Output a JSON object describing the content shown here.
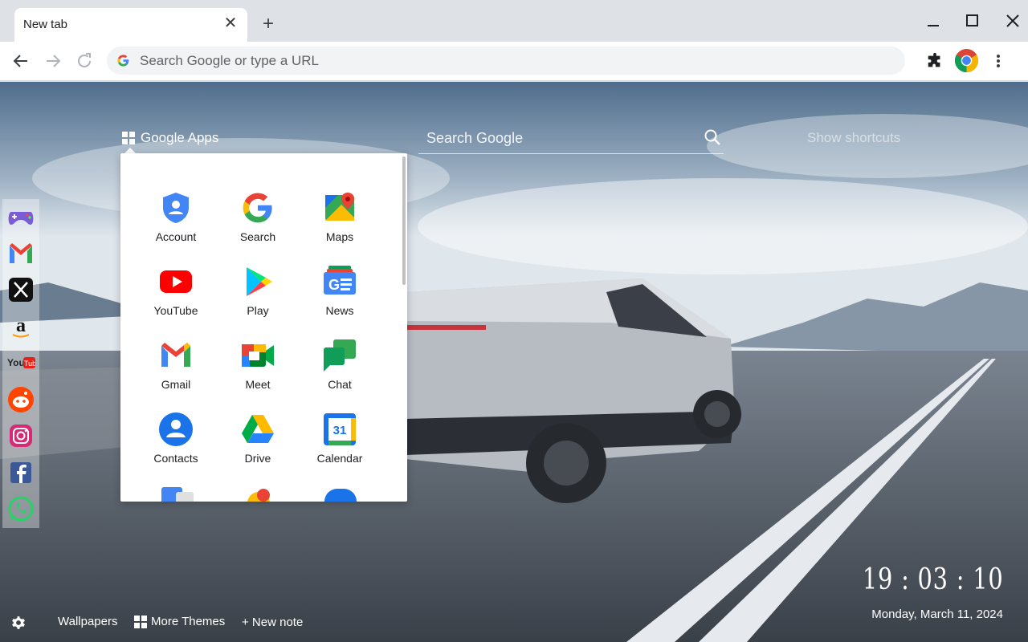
{
  "browser": {
    "tab_title": "New tab",
    "omnibox_placeholder": "Search Google or type a URL"
  },
  "newtab": {
    "apps_label": "Google Apps",
    "search_placeholder": "Search Google",
    "shortcuts_label": "Show shortcuts",
    "apps": [
      {
        "label": "Account",
        "icon": "account-icon"
      },
      {
        "label": "Search",
        "icon": "google-search-icon"
      },
      {
        "label": "Maps",
        "icon": "maps-icon"
      },
      {
        "label": "YouTube",
        "icon": "youtube-icon"
      },
      {
        "label": "Play",
        "icon": "play-icon"
      },
      {
        "label": "News",
        "icon": "news-icon"
      },
      {
        "label": "Gmail",
        "icon": "gmail-icon"
      },
      {
        "label": "Meet",
        "icon": "meet-icon"
      },
      {
        "label": "Chat",
        "icon": "chat-icon"
      },
      {
        "label": "Contacts",
        "icon": "contacts-icon"
      },
      {
        "label": "Drive",
        "icon": "drive-icon"
      },
      {
        "label": "Calendar",
        "icon": "calendar-icon"
      }
    ],
    "social": [
      "games-icon",
      "gmail-icon",
      "x-icon",
      "amazon-icon",
      "youtube-icon",
      "reddit-icon",
      "instagram-icon",
      "facebook-icon",
      "whatsapp-icon"
    ],
    "bottom": {
      "wallpapers": "Wallpapers",
      "more_themes": "More Themes",
      "new_note": "+ New note"
    },
    "clock": "19 : 03 : 10",
    "date": "Monday, March 11, 2024",
    "calendar_day": "31"
  }
}
